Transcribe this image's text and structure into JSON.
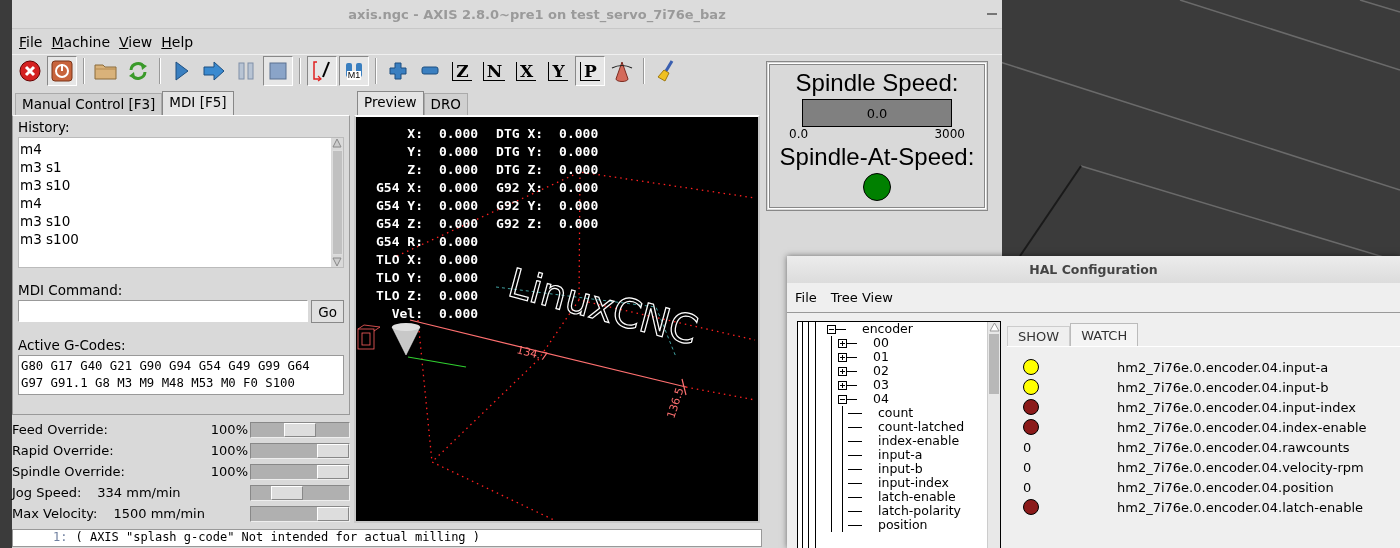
{
  "axis_window": {
    "title": "axis.ngc - AXIS 2.8.0~pre1 on test_servo_7i76e_baz",
    "menu": [
      {
        "label": "File"
      },
      {
        "label": "Machine"
      },
      {
        "label": "View"
      },
      {
        "label": "Help"
      }
    ],
    "toolbar": [
      {
        "kind": "estop",
        "pressed": false
      },
      {
        "kind": "power",
        "pressed": true
      },
      {
        "kind": "separator"
      },
      {
        "kind": "open",
        "pressed": false
      },
      {
        "kind": "reload",
        "pressed": false
      },
      {
        "kind": "separator"
      },
      {
        "kind": "run",
        "pressed": false
      },
      {
        "kind": "step",
        "pressed": false
      },
      {
        "kind": "pause",
        "pressed": false
      },
      {
        "kind": "stop",
        "pressed": true
      },
      {
        "kind": "separator"
      },
      {
        "kind": "block-delete",
        "pressed": true
      },
      {
        "kind": "optional-stop",
        "pressed": true,
        "label": "M1"
      },
      {
        "kind": "separator"
      },
      {
        "kind": "zoom-in",
        "pressed": false
      },
      {
        "kind": "zoom-out",
        "pressed": false
      },
      {
        "kind": "view",
        "pressed": false,
        "label": "Z"
      },
      {
        "kind": "view",
        "pressed": false,
        "label": "N"
      },
      {
        "kind": "view",
        "pressed": false,
        "label": "X"
      },
      {
        "kind": "view",
        "pressed": false,
        "label": "Y"
      },
      {
        "kind": "view",
        "pressed": true,
        "label": "P"
      },
      {
        "kind": "rotate",
        "pressed": false
      },
      {
        "kind": "separator"
      },
      {
        "kind": "clear",
        "pressed": false
      }
    ],
    "left_tabs": [
      {
        "label": "Manual Control [F3]",
        "selected": false
      },
      {
        "label": "MDI [F5]",
        "selected": true
      }
    ],
    "mdi": {
      "history_label": "History:",
      "history": [
        "m4",
        "m3 s1",
        "m3 s10",
        "m4",
        "m3 s10",
        "m3 s100"
      ],
      "command_label": "MDI Command:",
      "go_button": "Go",
      "gcodes_label": "Active G-Codes:",
      "gcodes_lines": [
        "G80 G17 G40 G21 G90 G94 G54 G49 G99 G64",
        "G97 G91.1 G8 M3 M9 M48 M53 M0 F0 S100"
      ]
    },
    "overrides": [
      {
        "kind": "percent",
        "label": "Feed Override:",
        "value": "100%",
        "level": 0.5
      },
      {
        "kind": "percent",
        "label": "Rapid Override:",
        "value": "100%",
        "level": 1
      },
      {
        "kind": "percent",
        "label": "Spindle Override:",
        "value": "100%",
        "level": 1
      },
      {
        "kind": "speed",
        "label": "Jog Speed:",
        "value": "334 mm/min",
        "level": 0.3
      },
      {
        "kind": "speed",
        "label": "Max Velocity:",
        "value": "1500 mm/min",
        "level": 1
      }
    ],
    "preview_tabs": [
      {
        "label": "Preview",
        "selected": true
      },
      {
        "label": "DRO",
        "selected": false
      }
    ],
    "dro": [
      {
        "label": "X:",
        "value": "0.000",
        "label2": "DTG X:",
        "value2": "0.000"
      },
      {
        "label": "Y:",
        "value": "0.000",
        "label2": "DTG Y:",
        "value2": "0.000"
      },
      {
        "label": "Z:",
        "value": "0.000",
        "label2": "DTG Z:",
        "value2": "0.000"
      },
      {
        "label": "G54 X:",
        "value": "0.000",
        "label2": "G92 X:",
        "value2": "0.000"
      },
      {
        "label": "G54 Y:",
        "value": "0.000",
        "label2": "G92 Y:",
        "value2": "0.000"
      },
      {
        "label": "G54 Z:",
        "value": "0.000",
        "label2": "G92 Z:",
        "value2": "0.000"
      },
      {
        "label": "G54 R:",
        "value": "0.000"
      },
      {
        "label": "TLO X:",
        "value": "0.000"
      },
      {
        "label": "TLO Y:",
        "value": "0.000"
      },
      {
        "label": "TLO Z:",
        "value": "0.000"
      },
      {
        "label": "Vel:",
        "value": "0.000"
      }
    ],
    "preview": {
      "splash_text": "LinuxCNC",
      "dimension_labels": [
        "134.7",
        "136.5"
      ]
    },
    "code": [
      {
        "line": "1:",
        "text": "( AXIS \"splash g-code\" Not intended for actual milling )"
      }
    ]
  },
  "spindle_panel": {
    "speed_label": "Spindle Speed:",
    "speed_bar": {
      "level": 0,
      "reading": "0.0",
      "min": "0.0",
      "max": "3000"
    },
    "at_speed_label": "Spindle-At-Speed:",
    "at_speed_led": {
      "on": true
    }
  },
  "hal_window": {
    "title": "HAL Configuration",
    "menu": [
      "File",
      "Tree View"
    ],
    "tree": [
      {
        "label": "encoder",
        "expanded": true,
        "children": [
          {
            "label": "00",
            "expanded": false
          },
          {
            "label": "01",
            "expanded": false
          },
          {
            "label": "02",
            "expanded": false
          },
          {
            "label": "03",
            "expanded": false
          },
          {
            "label": "04",
            "expanded": true,
            "children": [
              {
                "label": "count"
              },
              {
                "label": "count-latched"
              },
              {
                "label": "index-enable"
              },
              {
                "label": "input-a"
              },
              {
                "label": "input-b"
              },
              {
                "label": "input-index"
              },
              {
                "label": "latch-enable"
              },
              {
                "label": "latch-polarity"
              },
              {
                "label": "position"
              }
            ]
          }
        ]
      }
    ],
    "tabs": [
      {
        "label": "SHOW",
        "selected": false
      },
      {
        "label": "WATCH",
        "selected": true
      }
    ],
    "watch": [
      {
        "kind": "led",
        "on": true,
        "name": "hm2_7i76e.0.encoder.04.input-a"
      },
      {
        "kind": "led",
        "on": true,
        "name": "hm2_7i76e.0.encoder.04.input-b"
      },
      {
        "kind": "led",
        "on": false,
        "name": "hm2_7i76e.0.encoder.04.input-index"
      },
      {
        "kind": "led",
        "on": false,
        "name": "hm2_7i76e.0.encoder.04.index-enable"
      },
      {
        "kind": "value",
        "value": "0",
        "name": "hm2_7i76e.0.encoder.04.rawcounts"
      },
      {
        "kind": "value",
        "value": "0",
        "name": "hm2_7i76e.0.encoder.04.velocity-rpm"
      },
      {
        "kind": "value",
        "value": "0",
        "name": "hm2_7i76e.0.encoder.04.position"
      },
      {
        "kind": "led",
        "on": false,
        "name": "hm2_7i76e.0.encoder.04.latch-enable"
      }
    ]
  }
}
